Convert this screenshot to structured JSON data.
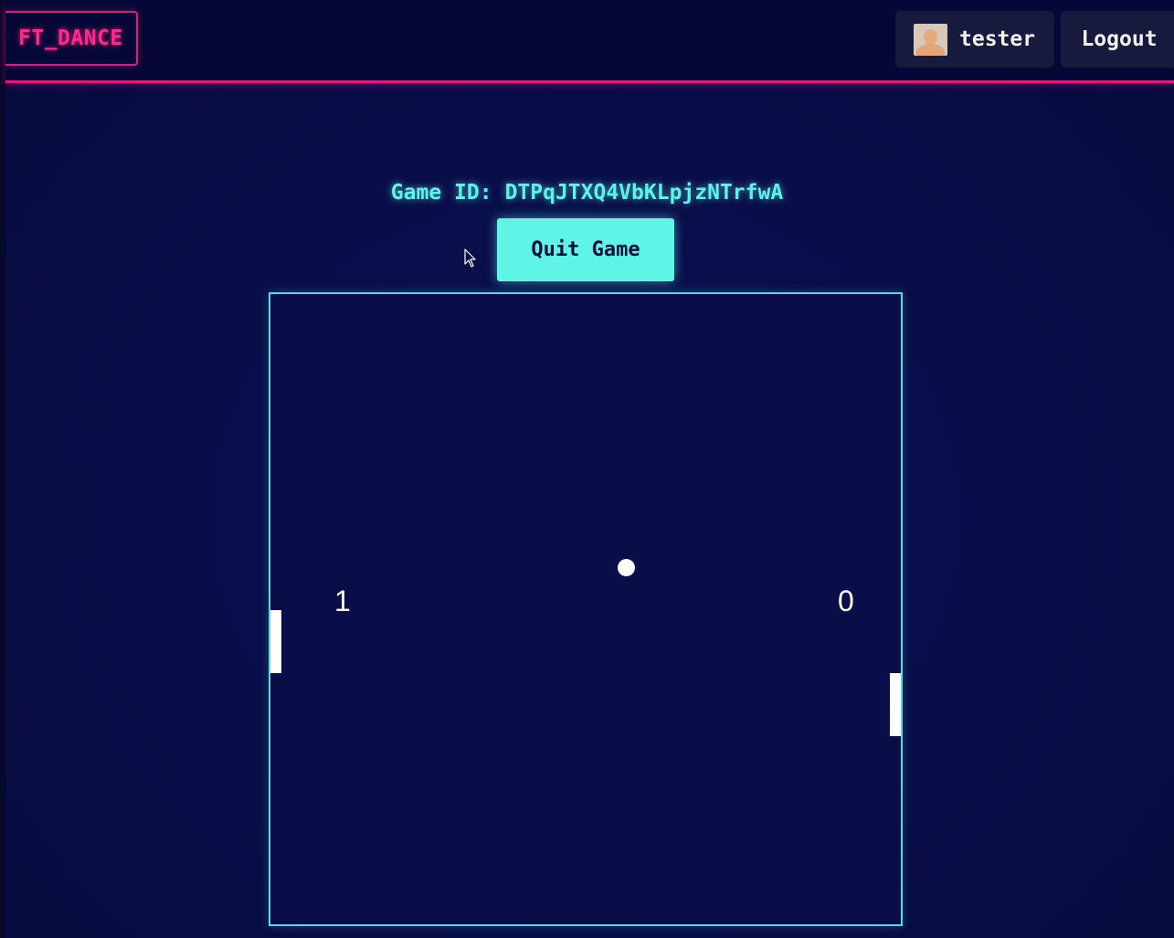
{
  "navbar": {
    "logo_text": "FT_DANCE",
    "username": "tester",
    "logout_label": "Logout",
    "accent_color": "#e0197c"
  },
  "game": {
    "id_label": "Game ID:",
    "id_value": "DTPqJTXQ4VbKLpjzNTrfwA",
    "quit_label": "Quit Game",
    "score_left": "1",
    "score_right": "0",
    "board_border_color": "#56d9e0",
    "button_color": "#5ff4e6"
  },
  "icons": {
    "avatar": "user-avatar-icon",
    "cursor": "mouse-pointer-icon"
  }
}
